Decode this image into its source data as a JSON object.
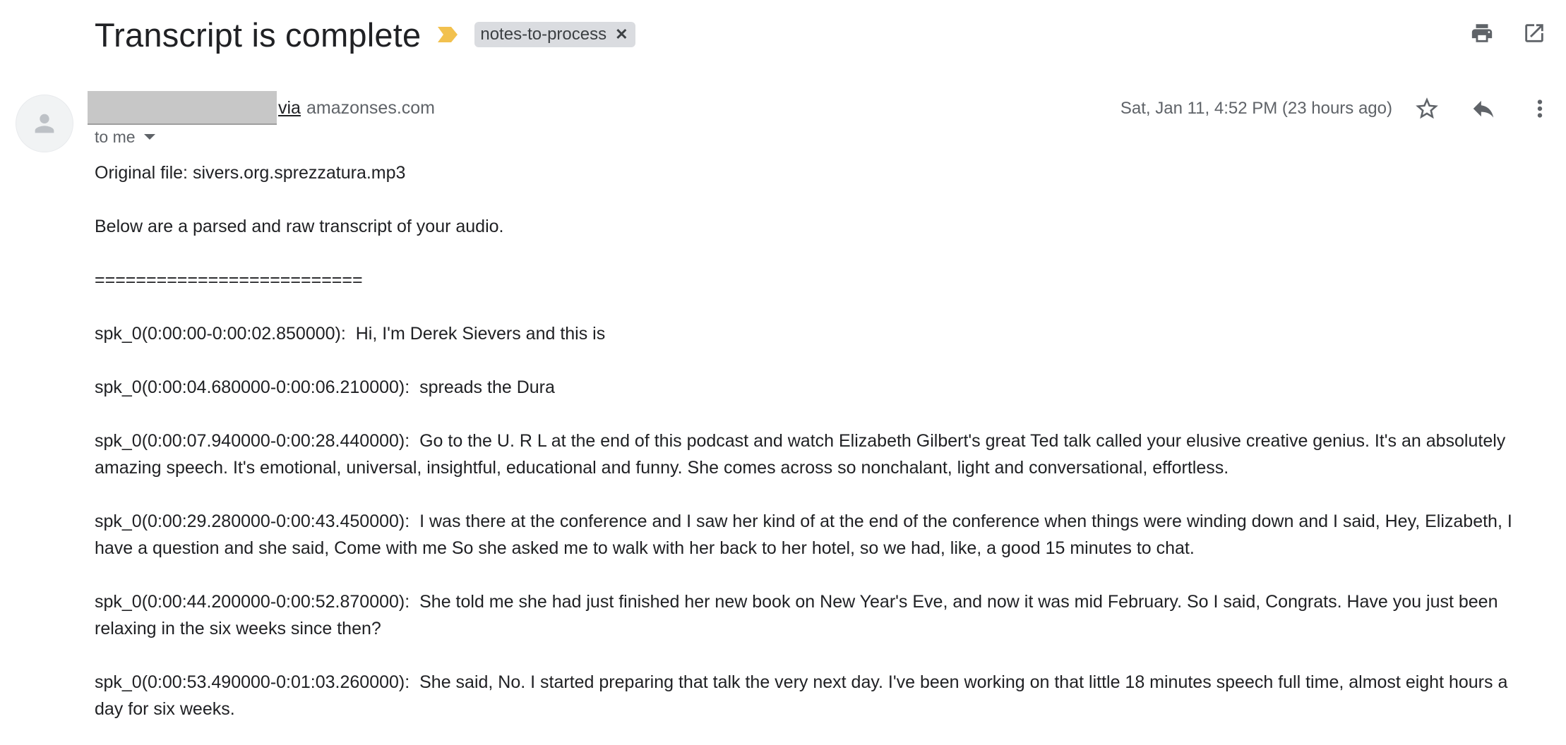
{
  "header": {
    "subject": "Transcript is complete",
    "label": "notes-to-process",
    "label_remove_glyph": "✕",
    "importance_color": "#f2c14e"
  },
  "sender": {
    "via_text": "via",
    "domain": "amazonses.com",
    "recipient": "to me",
    "date": "Sat, Jan 11, 4:52 PM (23 hours ago)"
  },
  "icons": {
    "print": "print-icon",
    "open_new_window": "open-in-new-window-icon",
    "star": "star-icon",
    "reply": "reply-icon",
    "more": "more-vert-icon",
    "avatar": "person-icon"
  },
  "body": {
    "original_file": "Original file: sivers.org.sprezzatura.mp3",
    "intro": "Below are a parsed and raw transcript of your audio.",
    "separator": "==========================",
    "segments": [
      {
        "label": "spk_0(0:00:00-0:00:02.850000):",
        "text": "Hi, I'm Derek Sievers and this is"
      },
      {
        "label": "spk_0(0:00:04.680000-0:00:06.210000):",
        "text": "spreads the Dura"
      },
      {
        "label": "spk_0(0:00:07.940000-0:00:28.440000):",
        "text": "Go to the U. R L at the end of this podcast and watch Elizabeth Gilbert's great Ted talk called your elusive creative genius. It's an absolutely amazing speech. It's emotional, universal, insightful, educational and funny. She comes across so nonchalant, light and conversational, effortless."
      },
      {
        "label": "spk_0(0:00:29.280000-0:00:43.450000):",
        "text": "I was there at the conference and I saw her kind of at the end of the conference when things were winding down and I said, Hey, Elizabeth, I have a question and she said, Come with me So she asked me to walk with her back to her hotel, so we had, like, a good 15 minutes to chat."
      },
      {
        "label": "spk_0(0:00:44.200000-0:00:52.870000):",
        "text": "She told me she had just finished her new book on New Year's Eve, and now it was mid February. So I said, Congrats. Have you just been relaxing in the six weeks since then?"
      },
      {
        "label": "spk_0(0:00:53.490000-0:01:03.260000):",
        "text": "She said, No. I started preparing that talk the very next day. I've been working on that little 18 minutes speech full time, almost eight hours a day for six weeks."
      }
    ]
  }
}
